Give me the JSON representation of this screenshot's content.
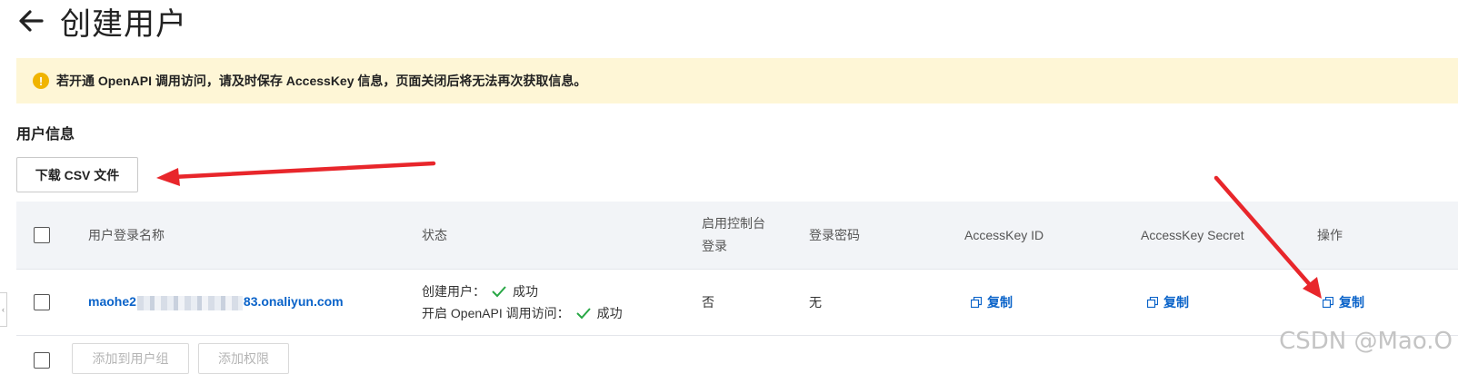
{
  "header": {
    "title": "创建用户",
    "back_icon": "arrow-left-icon"
  },
  "notice": {
    "icon": "warning-circle-icon",
    "icon_glyph": "!",
    "text": "若开通 OpenAPI 调用访问，请及时保存 AccessKey 信息，页面关闭后将无法再次获取信息。",
    "bg_color": "#fef6d6",
    "icon_color": "#f0b400"
  },
  "section": {
    "title": "用户信息",
    "download_label": "下载 CSV 文件"
  },
  "table": {
    "headers": {
      "username": "用户登录名称",
      "status": "状态",
      "console_login": "启用控制台",
      "console_login_2": "登录",
      "password": "登录密码",
      "ak_id": "AccessKey ID",
      "ak_secret": "AccessKey Secret",
      "actions": "操作"
    },
    "rows": [
      {
        "username_prefix": "maohe2",
        "username_suffix": "83.onaliyun.com",
        "status_create_label": "创建用户：",
        "status_create_value": "成功",
        "status_openapi_label": "开启 OpenAPI 调用访问：",
        "status_openapi_value": "成功",
        "console_login": "否",
        "password": "无",
        "ak_id_copy": "复制",
        "ak_secret_copy": "复制",
        "action_copy": "复制"
      }
    ]
  },
  "bottom_actions": {
    "add_to_group": "添加到用户组",
    "add_permission": "添加权限"
  },
  "watermark": "CSDN @Mao.O",
  "colors": {
    "link": "#0a63c9",
    "success": "#28a745",
    "annotation_arrow": "#e8262b"
  }
}
